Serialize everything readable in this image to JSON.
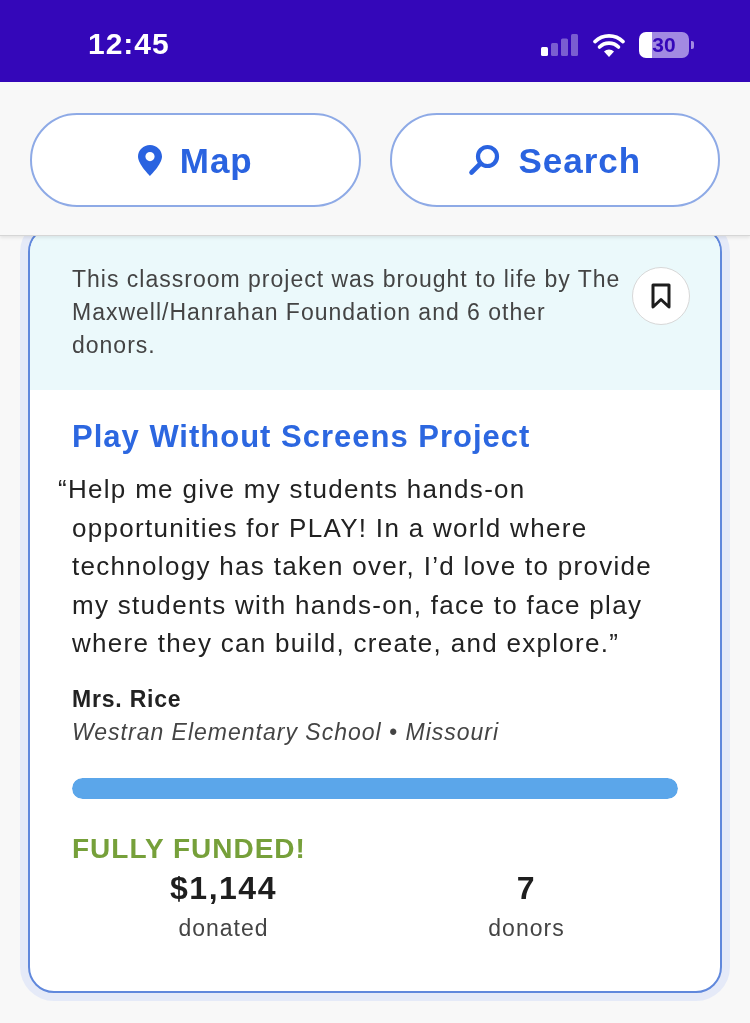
{
  "status_bar": {
    "time": "12:45",
    "battery": "30"
  },
  "header": {
    "buttons": [
      {
        "kind": "map",
        "label": "Map"
      },
      {
        "kind": "search",
        "label": "Search"
      }
    ]
  },
  "card": {
    "banner": "This classroom project was brought to life by The Maxwell/Hanrahan Foundation and 6 other donors.",
    "title": "Play Without Screens Project",
    "quote": "“Help me give my students hands-on opportunities for PLAY! In a world where technology has taken over, I’d love to provide my students with hands-on, face to face play where they can build, create, and explore.”",
    "teacher": "Mrs. Rice",
    "school": "Westran Elementary School • Missouri",
    "progress": {
      "level": 1
    },
    "status": "FULLY FUNDED!",
    "stats": [
      {
        "value": "$1,144",
        "label": "donated"
      },
      {
        "value": "7",
        "label": "donors"
      }
    ]
  }
}
